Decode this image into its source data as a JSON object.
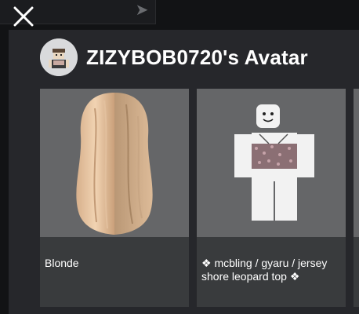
{
  "window": {
    "close_icon": "close-icon",
    "send_icon": "send-icon"
  },
  "header": {
    "title": "ZIZYBOB0720's Avatar",
    "avatar_icon": "avatar-headshot"
  },
  "items": [
    {
      "name": "Blonde",
      "thumbnail": "hair-icon"
    },
    {
      "name": "❖ mcbling / gyaru / jersey shore leopard top ❖",
      "thumbnail": "shirt-avatar-icon"
    },
    {
      "name": "",
      "thumbnail": ""
    }
  ],
  "colors": {
    "panel": "#26272b",
    "card": "#393b3d",
    "thumb_bg": "#656668",
    "text": "#ffffff"
  }
}
